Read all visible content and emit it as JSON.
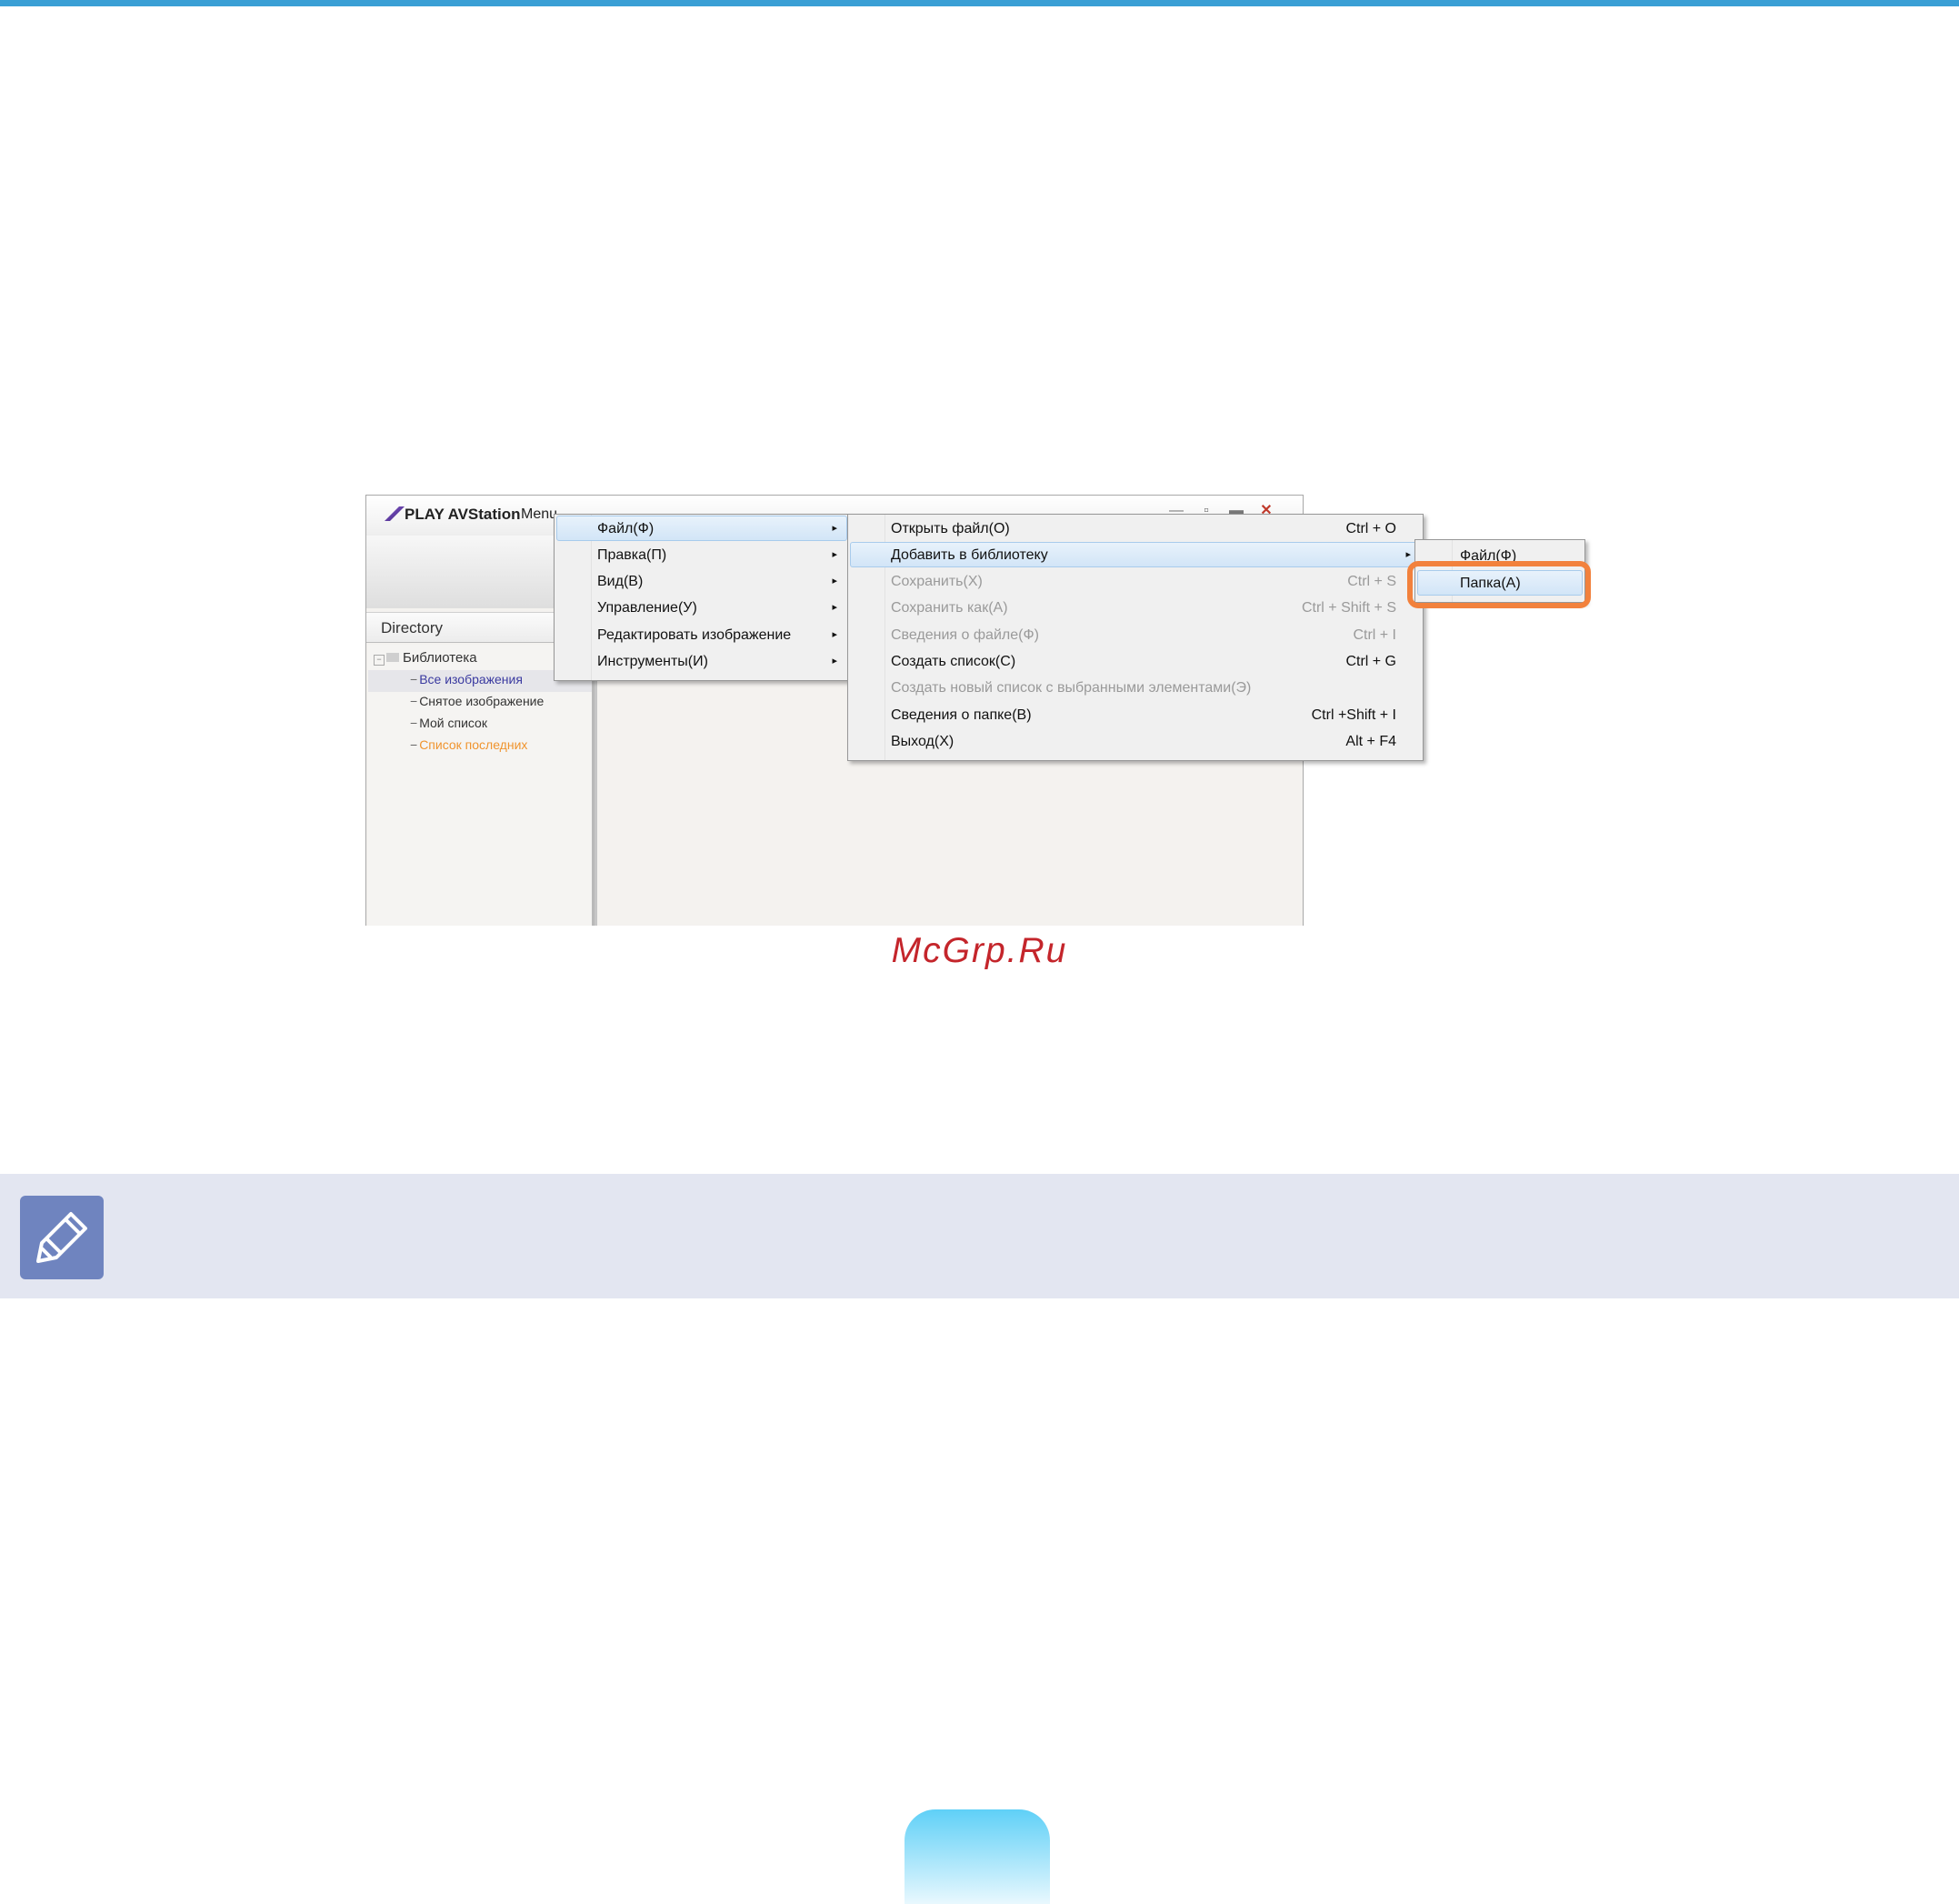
{
  "app": {
    "title": "PLAY AVStation",
    "menu_label": "Menu",
    "window_buttons": {
      "minimize": "—",
      "maximize": "▫",
      "restore": "▬",
      "close": "✕"
    },
    "directory_header": "Directory",
    "tree": {
      "root": "Библиотека",
      "items": [
        {
          "label": "Все изображения",
          "color": "#3a3aa0"
        },
        {
          "label": "Снятое изображение",
          "color": "#333333"
        },
        {
          "label": "Мой список",
          "color": "#333333"
        },
        {
          "label": "Список последних",
          "color": "#f0942e"
        }
      ]
    }
  },
  "menu_main": [
    {
      "label": "Файл(Ф)"
    },
    {
      "label": "Правка(П)"
    },
    {
      "label": "Вид(В)"
    },
    {
      "label": "Управление(У)"
    },
    {
      "label": "Редактировать изображение"
    },
    {
      "label": "Инструменты(И)"
    }
  ],
  "menu_file": [
    {
      "label": "Открыть файл(O)",
      "shortcut": "Ctrl + O"
    },
    {
      "label": "Добавить в библиотеку",
      "shortcut": ""
    },
    {
      "label": "Сохранить(X)",
      "shortcut": "Ctrl + S"
    },
    {
      "label": "Сохранить как(A)",
      "shortcut": "Ctrl + Shift + S"
    },
    {
      "label": "Сведения о файле(Ф)",
      "shortcut": "Ctrl + I"
    },
    {
      "label": "Создать список(C)",
      "shortcut": "Ctrl + G"
    },
    {
      "label": "Создать новый список с выбранными элементами(Э)",
      "shortcut": ""
    },
    {
      "label": "Сведения о папке(B)",
      "shortcut": "Ctrl +Shift + I"
    },
    {
      "label": "Выход(X)",
      "shortcut": "Alt + F4"
    }
  ],
  "menu_add": [
    {
      "label": "Файл(Ф)"
    },
    {
      "label": "Папка(A)"
    }
  ],
  "submenu_arrow": "▸",
  "watermark": "McGrp.Ru",
  "colors": {
    "accent": "#3a9fd5",
    "callout": "#f2813c",
    "note_bg": "#e3e6f1",
    "note_icon": "#6f84bf",
    "watermark": "#c4252b"
  },
  "icons": {
    "note": "pencil-note-icon"
  }
}
